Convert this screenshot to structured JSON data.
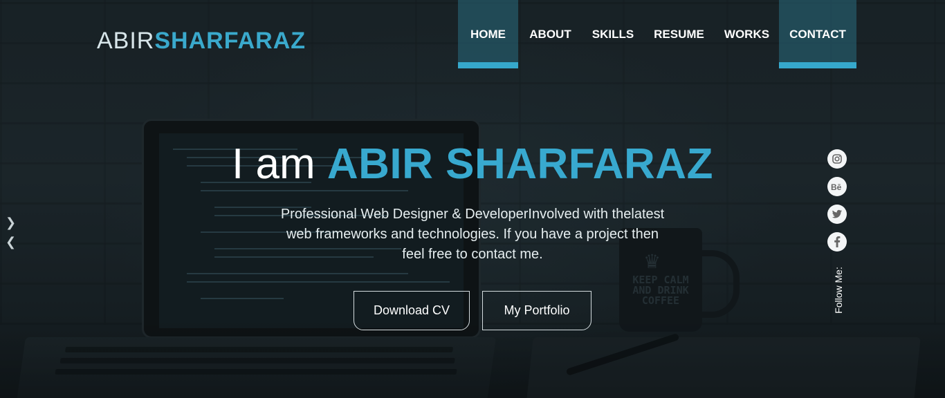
{
  "logo": {
    "first": "ABIR",
    "last": "SHARFARAZ"
  },
  "nav": {
    "items": [
      "HOME",
      "ABOUT",
      "SKILLS",
      "RESUME",
      "WORKS",
      "CONTACT"
    ],
    "active": [
      "HOME",
      "CONTACT"
    ]
  },
  "hero": {
    "lead": "I am",
    "name": "ABIR SHARFARAZ",
    "description": "Professional Web Designer & DeveloperInvolved with thelatest web frameworks and technologies. If you have a project then feel free to contact me.",
    "buttons": {
      "cv": "Download CV",
      "portfolio": "My Portfolio"
    }
  },
  "slider": {
    "next_icon": "chevron-right-icon",
    "prev_icon": "chevron-left-icon"
  },
  "social": {
    "label": "Follow Me:",
    "icons": [
      "instagram-icon",
      "behance-icon",
      "twitter-icon",
      "facebook-icon"
    ]
  },
  "background": {
    "mug_text": "KEEP CALM AND DRINK COFFEE"
  },
  "colors": {
    "accent": "#38a9cf",
    "nav_active_bg": "#276275",
    "text": "#ffffff"
  }
}
